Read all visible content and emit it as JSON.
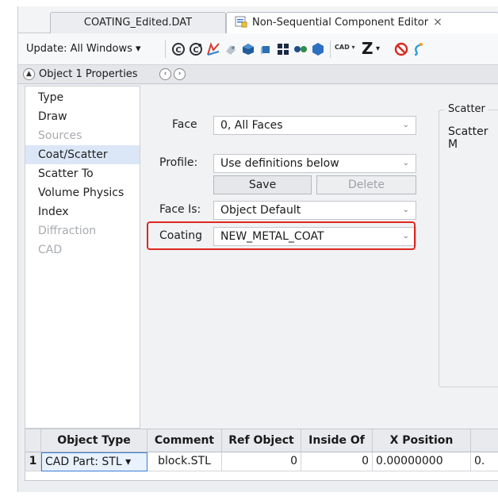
{
  "tabs": [
    {
      "label": "COATING_Edited.DAT",
      "active": false
    },
    {
      "label": "Non-Sequential Component Editor",
      "active": true,
      "close": "×"
    }
  ],
  "toolbar": {
    "update_label": "Update: All Windows",
    "update_caret": "▾",
    "icons": [
      "refresh-c-icon",
      "refresh-c-all-icon",
      "ray-trace-icon",
      "layout-3d-icon",
      "shaded-model-icon",
      "solid-model-icon",
      "grid-icon",
      "dots-icon",
      "hexagon-icon",
      "cad-dropdown-icon",
      "z-dropdown-icon",
      "stop-icon",
      "curve-icon"
    ],
    "cad_label": "CAD",
    "z_label": "Z"
  },
  "properties_bar": {
    "title": "Object 1 Properties"
  },
  "nav": {
    "items": [
      {
        "label": "Type",
        "state": "normal"
      },
      {
        "label": "Draw",
        "state": "normal"
      },
      {
        "label": "Sources",
        "state": "disabled"
      },
      {
        "label": "Coat/Scatter",
        "state": "selected"
      },
      {
        "label": "Scatter To",
        "state": "normal"
      },
      {
        "label": "Volume Physics",
        "state": "normal"
      },
      {
        "label": "Index",
        "state": "normal"
      },
      {
        "label": "Diffraction",
        "state": "disabled"
      },
      {
        "label": "CAD",
        "state": "disabled"
      }
    ]
  },
  "form": {
    "face_label": "Face",
    "face_value": "0, All Faces",
    "profile_label": "Profile:",
    "profile_value": "Use definitions below",
    "save_label": "Save",
    "delete_label": "Delete",
    "face_is_label": "Face Is:",
    "face_is_value": "Object Default",
    "coating_label": "Coating",
    "coating_value": "NEW_METAL_COAT",
    "scatter_title": "Scatter",
    "scatter_label": "Scatter M"
  },
  "grid": {
    "headers": [
      "Object Type",
      "Comment",
      "Ref Object",
      "Inside Of",
      "X Position"
    ],
    "rows": [
      {
        "num": "1",
        "object_type": "CAD Part: STL",
        "comment": "block.STL",
        "ref_object": "0",
        "inside_of": "0",
        "x_position": "0.00000000",
        "next": "0."
      }
    ]
  },
  "colors": {
    "highlight": "#e0281f",
    "selected_nav": "#dbe7f6",
    "accent": "#3a7bd5"
  }
}
